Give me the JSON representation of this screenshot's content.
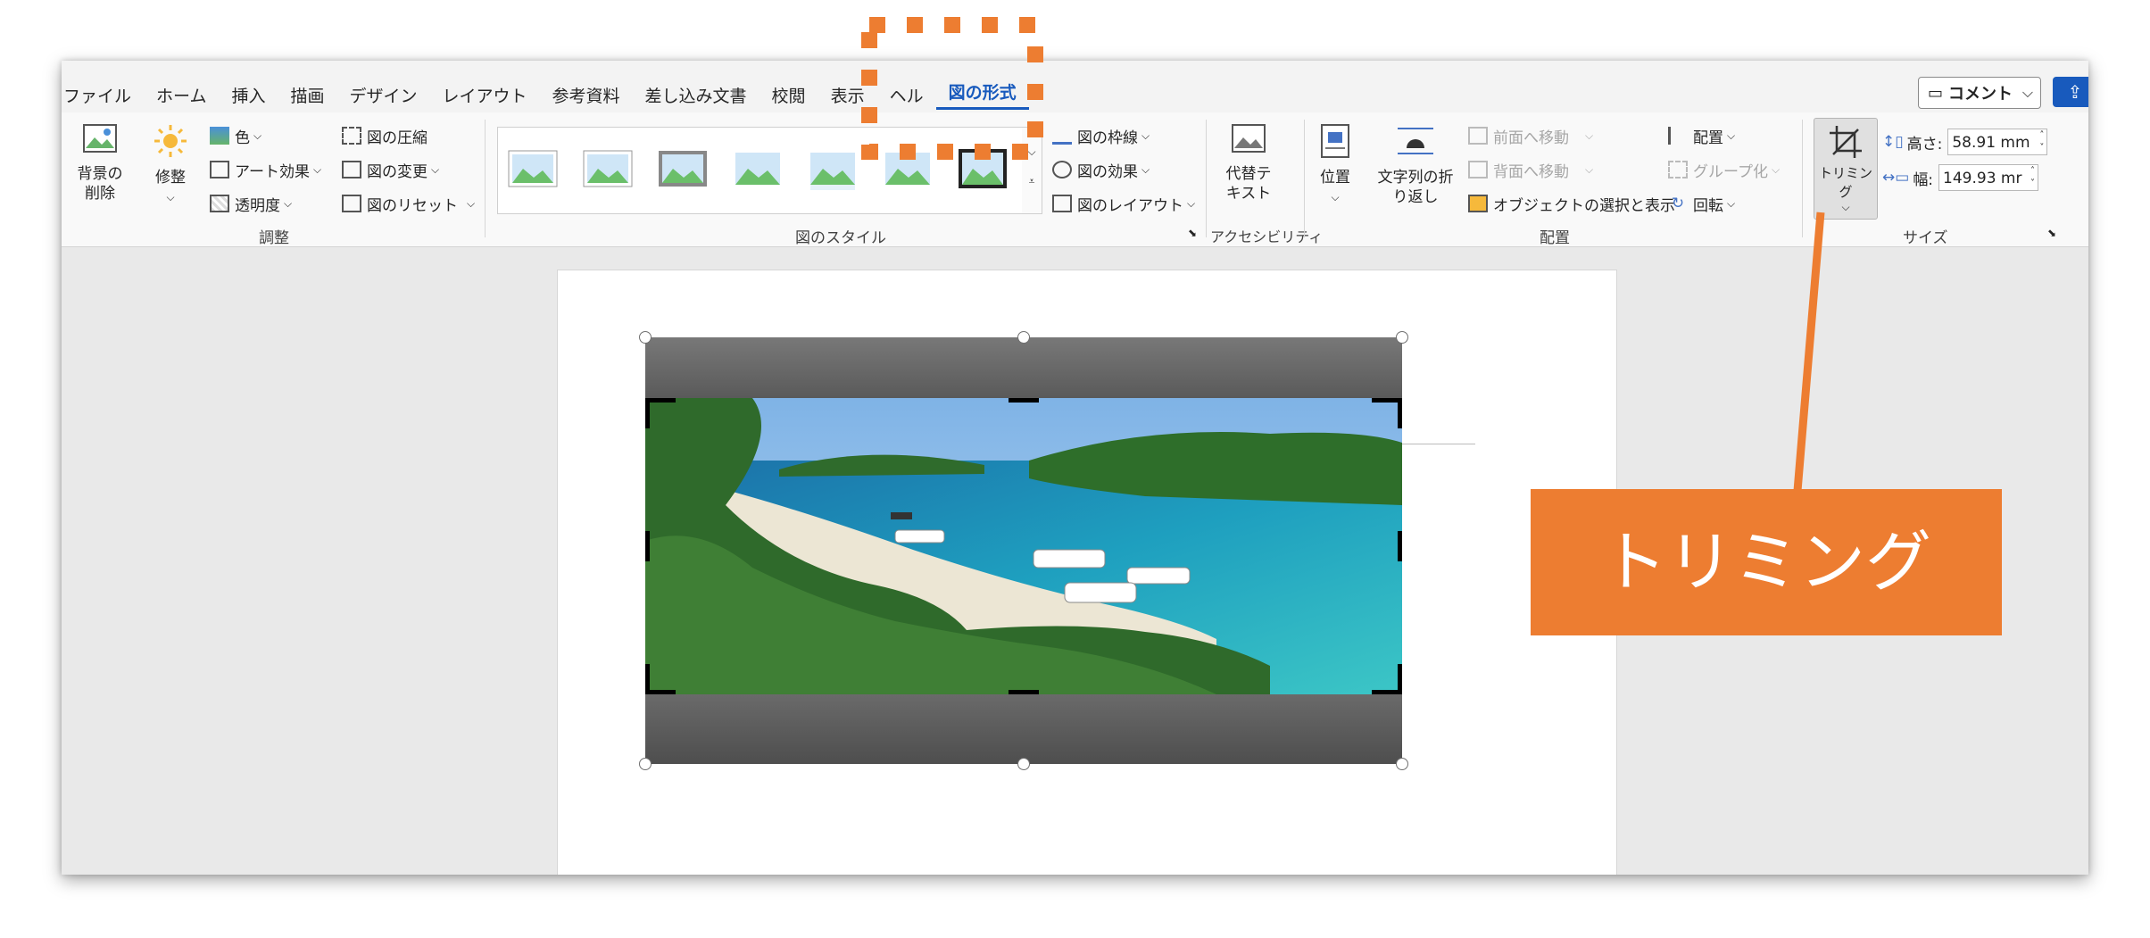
{
  "tabs": [
    "ファイル",
    "ホーム",
    "挿入",
    "描画",
    "デザイン",
    "レイアウト",
    "参考資料",
    "差し込み文書",
    "校閲",
    "表示",
    "ヘル",
    "図の形式"
  ],
  "active_tab": "図の形式",
  "titlebar": {
    "comment_label": "コメント",
    "comment_icon": "comment-icon",
    "share_icon": "share-icon"
  },
  "ribbon": {
    "adjust": {
      "remove_bg": "背景の\n削除",
      "corrections": "修整",
      "color": "色",
      "artistic": "アート効果",
      "transparency": "透明度",
      "compress": "図の圧縮",
      "change": "図の変更",
      "reset": "図のリセット",
      "label": "調整"
    },
    "styles": {
      "border": "図の枠線",
      "effects": "図の効果",
      "layout": "図のレイアウト",
      "label": "図のスタイル"
    },
    "accessibility": {
      "alt_text": "代替テ\nキスト",
      "label": "アクセシビリティ"
    },
    "arrange": {
      "position": "位置",
      "wrap": "文字列の折\nり返し",
      "bring_forward": "前面へ移動",
      "send_backward": "背面へ移動",
      "selection_pane": "オブジェクトの選択と表示",
      "align": "配置",
      "group": "グループ化",
      "rotate": "回転",
      "label": "配置"
    },
    "size": {
      "crop": "トリミング",
      "height_label": "高さ:",
      "height_value": "58.91 mm",
      "width_label": "幅:",
      "width_value": "149.93 mr",
      "label": "サイズ"
    }
  },
  "callout": {
    "text": "トリミング",
    "color": "#ed7d31"
  },
  "colors": {
    "accent": "#185abd",
    "orange": "#ed7d31"
  }
}
